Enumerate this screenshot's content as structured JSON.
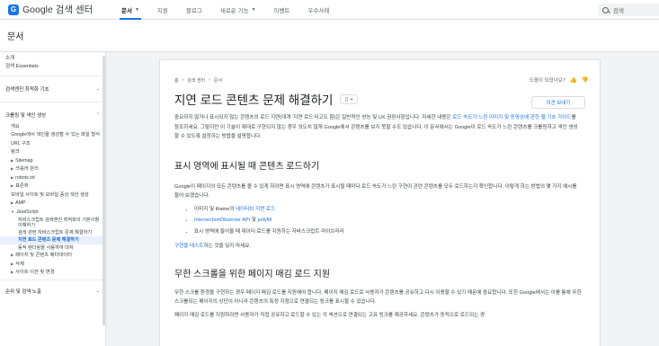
{
  "header": {
    "logo_mark": "G",
    "logo_text": "Google 검색 센터",
    "nav": [
      {
        "label": "문서",
        "active": true,
        "has_caret": true
      },
      {
        "label": "지원",
        "active": false,
        "has_caret": false
      },
      {
        "label": "블로그",
        "active": false,
        "has_caret": false
      },
      {
        "label": "새로운 기능",
        "active": false,
        "has_caret": true
      },
      {
        "label": "이벤트",
        "active": false,
        "has_caret": false
      },
      {
        "label": "우수사례",
        "active": false,
        "has_caret": false
      }
    ],
    "search_placeholder": "검색"
  },
  "section": {
    "title": "문서"
  },
  "sidebar": {
    "top_items": [
      "소개",
      "검색 Essentials"
    ],
    "group1": "검색엔진 최적화 기초",
    "group2": "크롤링 및 색인 생성",
    "sub_items": [
      "개요",
      "Google에서 색인을 생성할 수 있는 파일 형식",
      "URL 구조",
      "링크"
    ],
    "collapsible": [
      "Sitemap",
      "크롤러 관리"
    ],
    "robots": "robots.txt",
    "canonical": "표준화",
    "mobile": "모바일 사이트 및 모바일 중심 색인 생성",
    "amp": "AMP",
    "js": "JavaScript",
    "js_items": [
      "자바스크립트 검색엔진 최적화의 기본사항 이해하기",
      "검색 관련 자바스크립트 문제 해결하기",
      "지연 로드 콘텐츠 문제 해결하기",
      "동적 렌더링을 사용하여 대처"
    ],
    "bottom_items": [
      "페이지 및 콘텐츠 메타데이터",
      "삭제",
      "사이트 이전 및 변경"
    ],
    "group3": "순위 및 검색 노출"
  },
  "article": {
    "breadcrumb": [
      "홈",
      "검색 센터",
      "문서"
    ],
    "feedback_label": "도움이 되었나요?",
    "title": "지연 로드 콘텐츠 문제 해결하기",
    "opinion_button": "의견 보내기",
    "intro": {
      "part1": "중요하지 않거나 표시되지 않는 콘텐츠의 로드 지연(대개 '지연 로드'라고도 함)은 일반적인 성능 및 UX 권장사항입니다. 자세한 내용은 ",
      "link1": "로드 속도가 느린 이미지 및 동영상에 관한 웹 기초 가이드",
      "part2": "를 참조하세요. 그렇지만 이 기술이 제대로 구현되지 않는 경우 의도치 않게 Google에서 콘텐츠를 보지 못할 수도 있습니다. 이 문서에서는 Google이 로드 속도가 느린 콘텐츠를 크롤링하고 색인 생성할 수 있도록 설정하는 방법을 설명합니다."
    },
    "h2_1": "표시 영역에 표시될 때 콘텐츠 로드하기",
    "para2": "Google이 페이지의 모든 콘텐츠를 볼 수 있게 하려면 표시 영역에 콘텐츠가 표시될 때마다 로드 속도가 느린 구현이 관련 콘텐츠를 모두 로드하는지 확인합니다. 이렇게 하는 방법의 몇 가지 예시를 들어 보겠습니다.",
    "list": [
      {
        "pre": "이미지 및 iframe의 ",
        "link": "네이티브 지연 로드",
        "post": ""
      },
      {
        "pre": "",
        "link": "IntersectionObserver API",
        "mid": " 및 ",
        "link2": "polyfill",
        "post": ""
      },
      {
        "pre": "표시 영역에 들어올 때 데이터 로드를 지원하는 자바스크립트 라이브러리",
        "link": "",
        "post": ""
      }
    ],
    "test_link": "구현을 테스트",
    "test_rest": "하는 것을 잊지 마세요.",
    "h2_2": "무한 스크롤을 위한 페이지 매김 로드 지원",
    "para3": "무한 스크롤 환경을 구현하는 경우 페이지 매김 로드를 지원해야 합니다. 페이지 매김 로드로 사용자가 콘텐츠를 공유하고 다시 이용할 수 있기 때문에 중요합니다. 또한 Google에서는 이를 통해 무한 스크롤되는 페이지의 상단이 아니라 콘텐츠의 특정 지점으로 연결되는 링크를 표시할 수 있습니다.",
    "para4": "페이지 매김 로드를 지원하려면 사용자가 직접 공유하고 로드할 수 있는 각 섹션으로 연결되는 고유 링크를 제공하세요. 콘텐츠가 동적으로 로드되는 경"
  }
}
